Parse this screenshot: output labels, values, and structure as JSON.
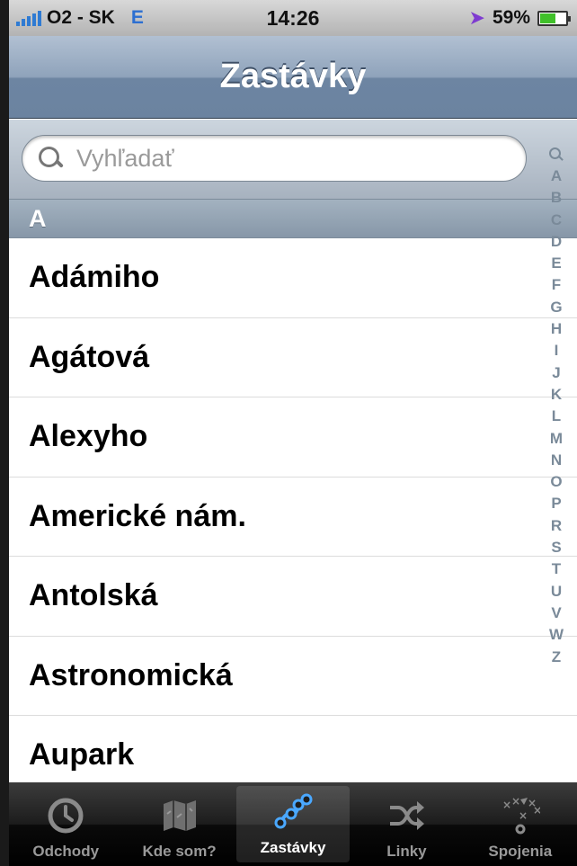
{
  "status_bar": {
    "carrier": "O2 - SK",
    "network": "E",
    "time": "14:26",
    "battery_percent": "59%",
    "battery_level": 0.59,
    "location_icon": "location-arrow-icon",
    "signal_icon": "signal-bars-icon"
  },
  "nav": {
    "title": "Zastávky"
  },
  "search": {
    "placeholder": "Vyhľadať"
  },
  "section": {
    "header": "A"
  },
  "list": {
    "items": [
      "Adámiho",
      "Agátová",
      "Alexyho",
      "Americké nám.",
      "Antolská",
      "Astronomická",
      "Aupark"
    ]
  },
  "index": {
    "letters": [
      "A",
      "B",
      "C",
      "D",
      "E",
      "F",
      "G",
      "H",
      "I",
      "J",
      "K",
      "L",
      "M",
      "N",
      "O",
      "P",
      "R",
      "S",
      "T",
      "U",
      "V",
      "W",
      "Z"
    ]
  },
  "tabs": [
    {
      "label": "Odchody",
      "icon": "clock-icon",
      "active": false
    },
    {
      "label": "Kde som?",
      "icon": "map-icon",
      "active": false
    },
    {
      "label": "Zastávky",
      "icon": "stops-icon",
      "active": true
    },
    {
      "label": "Linky",
      "icon": "shuffle-icon",
      "active": false
    },
    {
      "label": "Spojenia",
      "icon": "route-icon",
      "active": false
    }
  ],
  "colors": {
    "nav_bar": "#8fa3bb",
    "active_tab_icon": "#4aa8ff",
    "location_arrow": "#7e3bd0",
    "battery_fill": "#40c02a"
  }
}
